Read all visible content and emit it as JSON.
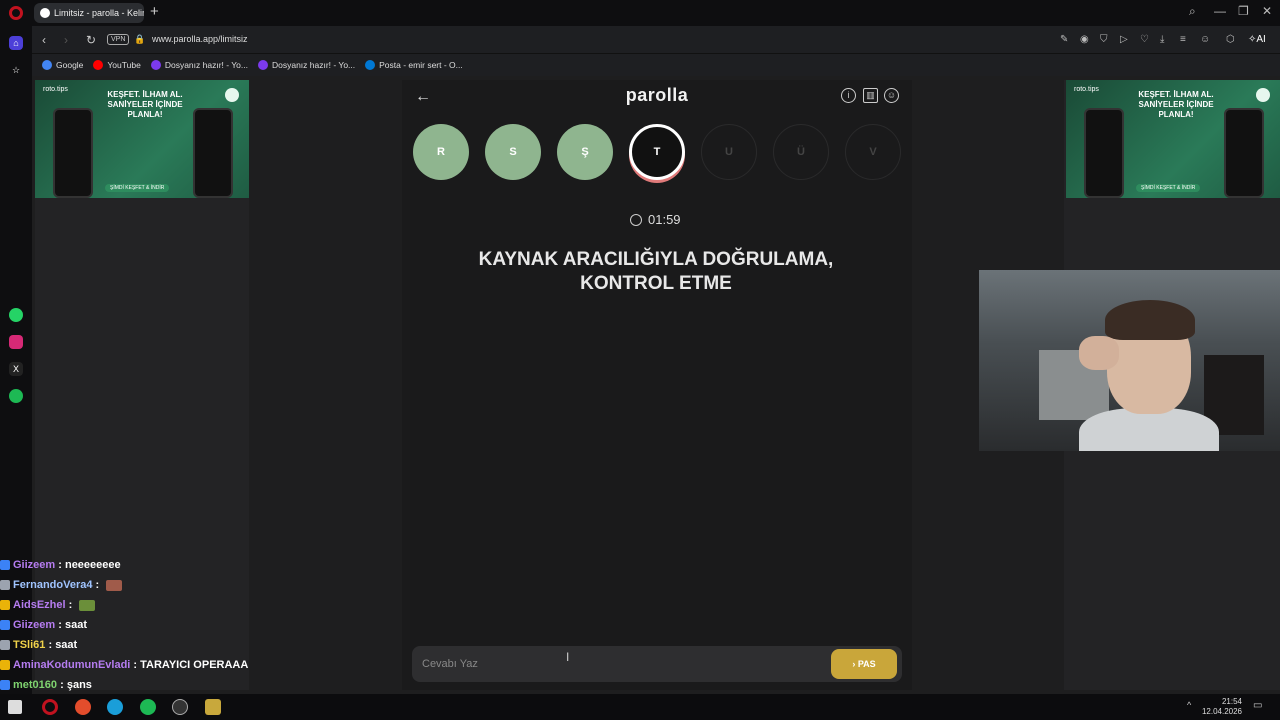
{
  "browser": {
    "tab_title": "Limitsiz - parolla - Kelime",
    "new_tab": "+",
    "vpn_label": "VPN",
    "url": "www.parolla.app/limitsiz",
    "ai_label": "AI"
  },
  "bookmarks": [
    {
      "label": "Google",
      "color": "#4285f4"
    },
    {
      "label": "YouTube",
      "color": "#ff0000"
    },
    {
      "label": "Dosyanız hazır! - Yo...",
      "color": "#7c3aed"
    },
    {
      "label": "Dosyanız hazır! - Yo...",
      "color": "#7c3aed"
    },
    {
      "label": "Posta - emir sert - O...",
      "color": "#0078d4"
    }
  ],
  "ads": {
    "brand": "roto.tips",
    "headline": "KEŞFET. İLHAM AL. SANİYELER İÇİNDE PLANLA!",
    "cta": "ŞİMDİ KEŞFET & İNDİR"
  },
  "game": {
    "logo": "parolla",
    "letters": [
      {
        "char": "R",
        "state": "done"
      },
      {
        "char": "S",
        "state": "done"
      },
      {
        "char": "Ş",
        "state": "done"
      },
      {
        "char": "T",
        "state": "active"
      },
      {
        "char": "U",
        "state": "todo"
      },
      {
        "char": "Ü",
        "state": "todo"
      },
      {
        "char": "V",
        "state": "todo"
      }
    ],
    "timer": "01:59",
    "question": "KAYNAK ARACILIĞIYLA DOĞRULAMA, KONTROL ETME",
    "answer_placeholder": "Cevabı Yaz",
    "pass_label": "PAS",
    "pass_icon": "›"
  },
  "chat": [
    {
      "user": "Giizeem",
      "text": "neeeeeeee",
      "user_color": "#b57cf0"
    },
    {
      "user": "FernandoVera4",
      "text": "",
      "user_color": "#a0c4ff"
    },
    {
      "user": "AidsEzhel",
      "text": "",
      "user_color": "#b57cf0"
    },
    {
      "user": "Giizeem",
      "text": "saat",
      "user_color": "#b57cf0"
    },
    {
      "user": "TSli61",
      "text": "saat",
      "user_color": "#f0d24a"
    },
    {
      "user": "AminaKodumunEvladi",
      "text": "TARAYICI OPERAAA",
      "user_color": "#b57cf0"
    },
    {
      "user": "met0160",
      "text": "şans",
      "user_color": "#7fd36f"
    }
  ],
  "taskbar": {
    "time": "21:54",
    "date": "12.04.2026"
  },
  "colors": {
    "done": "#8fb58f",
    "pass": "#c9a63a",
    "opera": "#c1121f"
  }
}
